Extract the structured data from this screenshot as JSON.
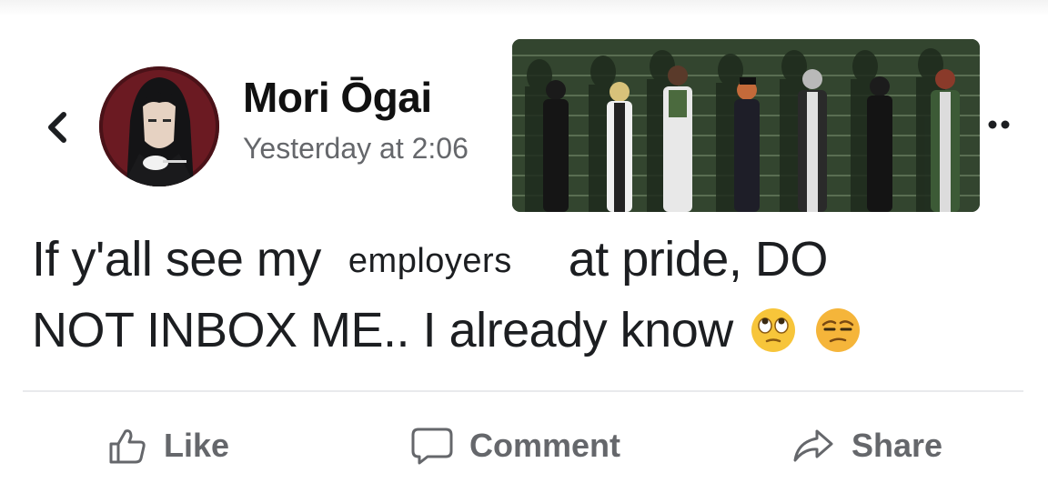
{
  "post": {
    "author": "Mori Ōgai",
    "timestamp": "Yesterday at 2:06",
    "text_line1_before": "If y'all see my",
    "text_edited_word": "employers",
    "text_line1_after": "at pride, DO",
    "text_line2": "NOT INBOX ME.. I already know"
  },
  "icons": {
    "back": "chevron-left-icon",
    "more": "more-dots-icon",
    "emoji1": "eye-roll-emoji",
    "emoji2": "unamused-emoji",
    "like": "thumbs-up-icon",
    "comment": "speech-bubble-icon",
    "share": "share-arrow-icon"
  },
  "actions": {
    "like": "Like",
    "comment": "Comment",
    "share": "Share"
  },
  "colors": {
    "text": "#1c1e21",
    "secondary": "#65676b",
    "avatar_bg": "#4a1218",
    "image_bg": "#2f3f2c"
  }
}
